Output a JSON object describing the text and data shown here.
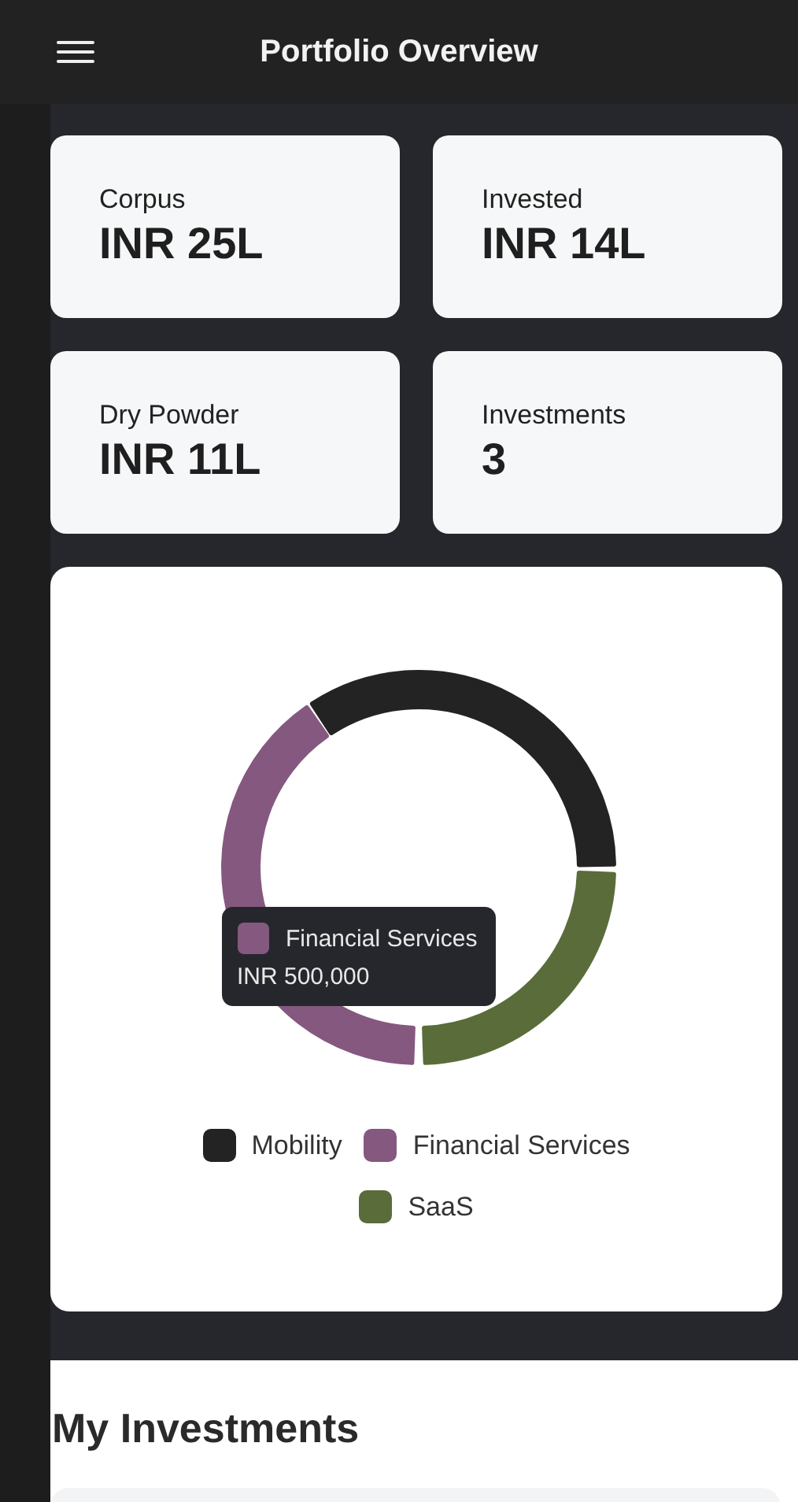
{
  "header": {
    "title": "Portfolio Overview"
  },
  "stats": [
    {
      "label": "Corpus",
      "value": "INR 25L"
    },
    {
      "label": "Invested",
      "value": "INR 14L"
    },
    {
      "label": "Dry Powder",
      "value": "INR 11L"
    },
    {
      "label": "Investments",
      "value": "3"
    }
  ],
  "donut": {
    "tooltip": {
      "label": "Financial Services",
      "value": "INR 500,000",
      "color": "#85587f"
    },
    "legend": [
      {
        "label": "Mobility",
        "color": "#232323"
      },
      {
        "label": "Financial Services",
        "color": "#85587f"
      },
      {
        "label": "SaaS",
        "color": "#5a6c39"
      }
    ]
  },
  "investments": {
    "title": "My Investments"
  }
}
